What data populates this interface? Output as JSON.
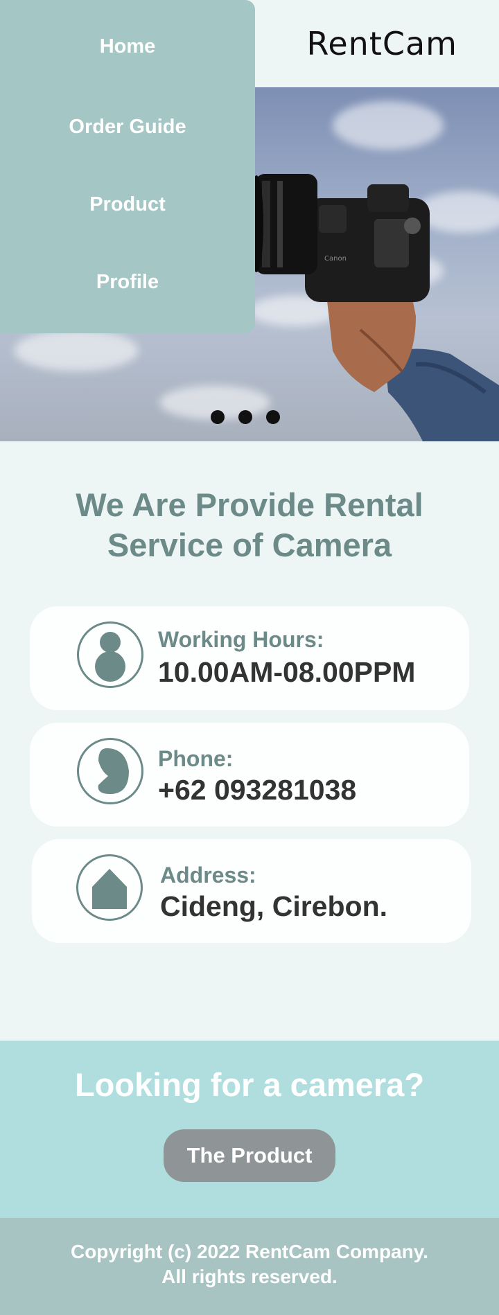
{
  "header": {
    "brand": "RentCam"
  },
  "menu": {
    "items": [
      {
        "label": "Home"
      },
      {
        "label": "Order Guide"
      },
      {
        "label": "Product"
      },
      {
        "label": "Profile"
      }
    ]
  },
  "hero": {
    "slides": 3,
    "image": "camera-in-hand"
  },
  "headline": {
    "line1": "We Are Provide Rental",
    "line2": "Service of Camera"
  },
  "info_cards": [
    {
      "icon": "person-icon",
      "label": "Working Hours:",
      "value": "10.00AM-08.00PPM"
    },
    {
      "icon": "phone-icon",
      "label": "Phone:",
      "value": "+62 093281038"
    },
    {
      "icon": "home-icon",
      "label": "Address:",
      "value": "Cideng, Cirebon."
    }
  ],
  "cta": {
    "title": "Looking for a camera?",
    "button_label": "The Product"
  },
  "footer": {
    "line1": "Copyright (c) 2022 RentCam Company.",
    "line2": "All rights reserved."
  },
  "colors": {
    "accent": "#6b8a88",
    "menu_bg": "#a4c6c4",
    "cta_bg": "#b0dedf",
    "footer_bg": "#a7c4c3",
    "page_bg": "#eef6f5",
    "button_bg": "#8f9596"
  }
}
